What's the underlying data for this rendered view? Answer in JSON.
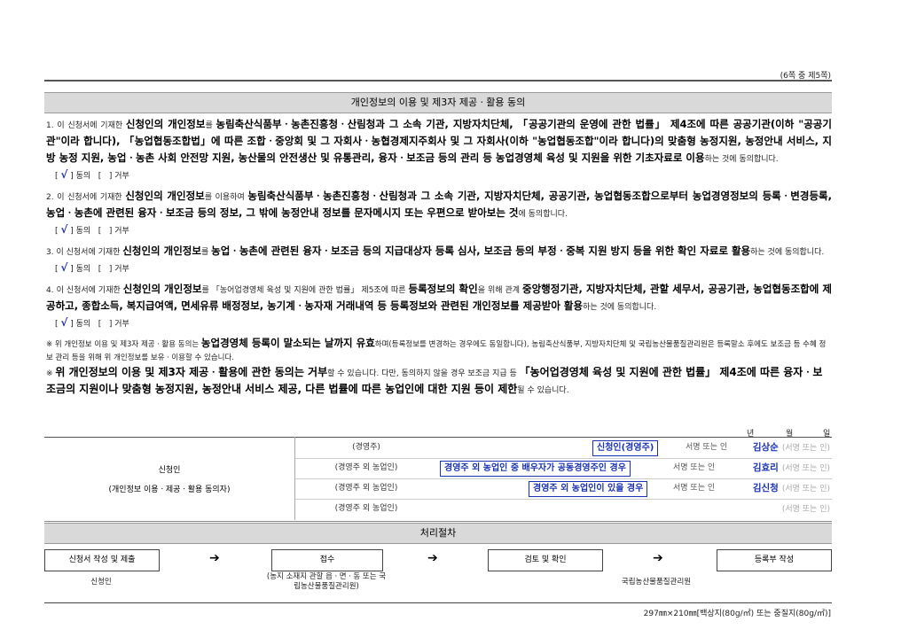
{
  "page_indicator": "(6쪽 중 제5쪽)",
  "title": "개인정보의 이용 및 제3자 제공ㆍ활용 동의",
  "items": [
    {
      "num": "1.",
      "t1": "이 신청서에 기재한 ",
      "b1": "신청인의 개인정보",
      "t2": "를 ",
      "b2": "농림축산식품부ㆍ농촌진흥청ㆍ산림청과 그 소속 기관, 지방자치단체, 「공공기관의 운영에 관한 법률」 제4조에 따른 공공기관(이하 \"공공기관\"이라 합니다), 「농업협동조합법」에 따른 조합ㆍ중앙회 및 그 자회사ㆍ농협경제지주회사 및 그 자회사(이하 \"농업협동조합\"이라 합니다)의 맞춤형 농정지원, 농정안내 서비스, 지방 농정 지원, 농업ㆍ농촌 사회 안전망 지원, 농산물의 안전생산 및 유통관리, 융자ㆍ보조금 등의 관리 등 농업경영체 육성 및 지원을 위한 기초자료로 이용",
      "t3": "하는 것에 동의합니다."
    },
    {
      "num": "2.",
      "t1": "이 신청서에 기재한 ",
      "b1": "신청인의 개인정보",
      "t2": "를 이용하여 ",
      "b2": "농림축산식품부ㆍ농촌진흥청ㆍ산림청과 그 소속 기관, 지방자치단체, 공공기관, 농업협동조합으로부터 농업경영정보의 등록ㆍ변경등록, 농업ㆍ농촌에 관련된 융자ㆍ보조금 등의 정보, 그 밖에 농정안내 정보를 문자메시지 또는 우편으로 받아보는 것",
      "t3": "에 동의합니다."
    },
    {
      "num": "3.",
      "t1": "이 신청서에 기재한 ",
      "b1": "신청인의 개인정보",
      "t2": "를 ",
      "b2": "농업ㆍ농촌에 관련된 융자ㆍ보조금 등의 지급대상자 등록 심사, 보조금 등의 부정ㆍ중복 지원 방지 등을 위한 확인 자료로 활용",
      "t3": "하는 것에 동의합니다."
    },
    {
      "num": "4.",
      "t1": "이 신청서에 기재한 ",
      "b1": "신청인의 개인정보",
      "t2": "를 「농어업경영체 육성 및 지원에 관한 법률」 제5조에 따른 ",
      "b2": "등록정보의 확인",
      "t3": "을 위해 관계 ",
      "b3": "중앙행정기관, 지방자치단체, 관할 세무서, 공공기관, 농업협동조합에 제공하고, 종합소득, 복지급여액, 면세유류 배정정보, 농기계ㆍ농자재 거래내역 등 등록정보와 관련된 개인정보를 제공받아 활용",
      "t4": "하는 것에 동의합니다."
    }
  ],
  "consent": {
    "agree_mark": "√",
    "agree": "동의",
    "disagree": "거부"
  },
  "note1": {
    "t1": "※ 위 개인정보 이용 및 제3자 제공ㆍ활용 동의는 ",
    "b1": "농업경영체 등록이 말소되는 날까지 유효",
    "t2": "하며(등록정보를 변경하는 경우에도 동일합니다), 농림축산식품부, 지방자치단체 및 국립농산물품질관리원은 등록말소 후에도 보조금 등 수혜 정보 관리 등을 위해 위 개인정보를 보유ㆍ이용할 수 있습니다."
  },
  "note2": {
    "t1": "※ ",
    "b1": "위 개인정보의 이용 및 제3자 제공ㆍ활용에 관한 동의는 거부",
    "t2": "할 수 있습니다. 다만, 동의하지 않을 경우 보조금 지급 등 ",
    "b2": "「농어업경영체 육성 및 지원에 관한 법률」 제4조에 따른 융자ㆍ보조금의 지원이나 맞춤형 농정지원, 농정안내 서비스 제공, 다른 법률에 따른 농업인에 대한 지원 등이 제한",
    "t3": "될 수 있습니다."
  },
  "date": {
    "year": "년",
    "month": "월",
    "day": "일"
  },
  "applicant": {
    "label": "신청인",
    "sublabel": "(개인정보 이용ㆍ제공ㆍ활용 동의자)"
  },
  "signers": [
    {
      "role": "(경영주)",
      "highlight": "신청인(경영주)",
      "sign_label": "서명 또는 인",
      "name": "김상순",
      "sign_label2": "(서명 또는 인)"
    },
    {
      "role": "(경영주 외 농업인)",
      "highlight": "경영주 외 농업인 중 배우자가 공동경영주인 경우",
      "sign_label": "서명 또는 인",
      "name": "김효리",
      "sign_label2": "(서명 또는 인)"
    },
    {
      "role": "(경영주 외 농업인)",
      "highlight": "경영주 외 농업인이 있을 경우",
      "sign_label": "서명 또는 인",
      "name": "김신청",
      "sign_label2": "(서명 또는 인)"
    },
    {
      "role": "(경영주 외 농업인)",
      "highlight": "",
      "sign_label": "",
      "name": "",
      "sign_label2": "(서명 또는 인)"
    }
  ],
  "process": {
    "title": "처리절차",
    "steps": [
      "신청서 작성 및 제출",
      "접수",
      "검토 및 확인",
      "등록부 작성"
    ],
    "arrow": "➔",
    "actor1": "신청인",
    "actor2": "(농지 소재지 관할 읍ㆍ면ㆍ동 또는 국립농산물품질관리원)",
    "actor3": "국립농산물품질관리원"
  },
  "paper_spec": "297㎜×210㎜[백상지(80g/㎡) 또는 중질지(80g/㎡)]"
}
